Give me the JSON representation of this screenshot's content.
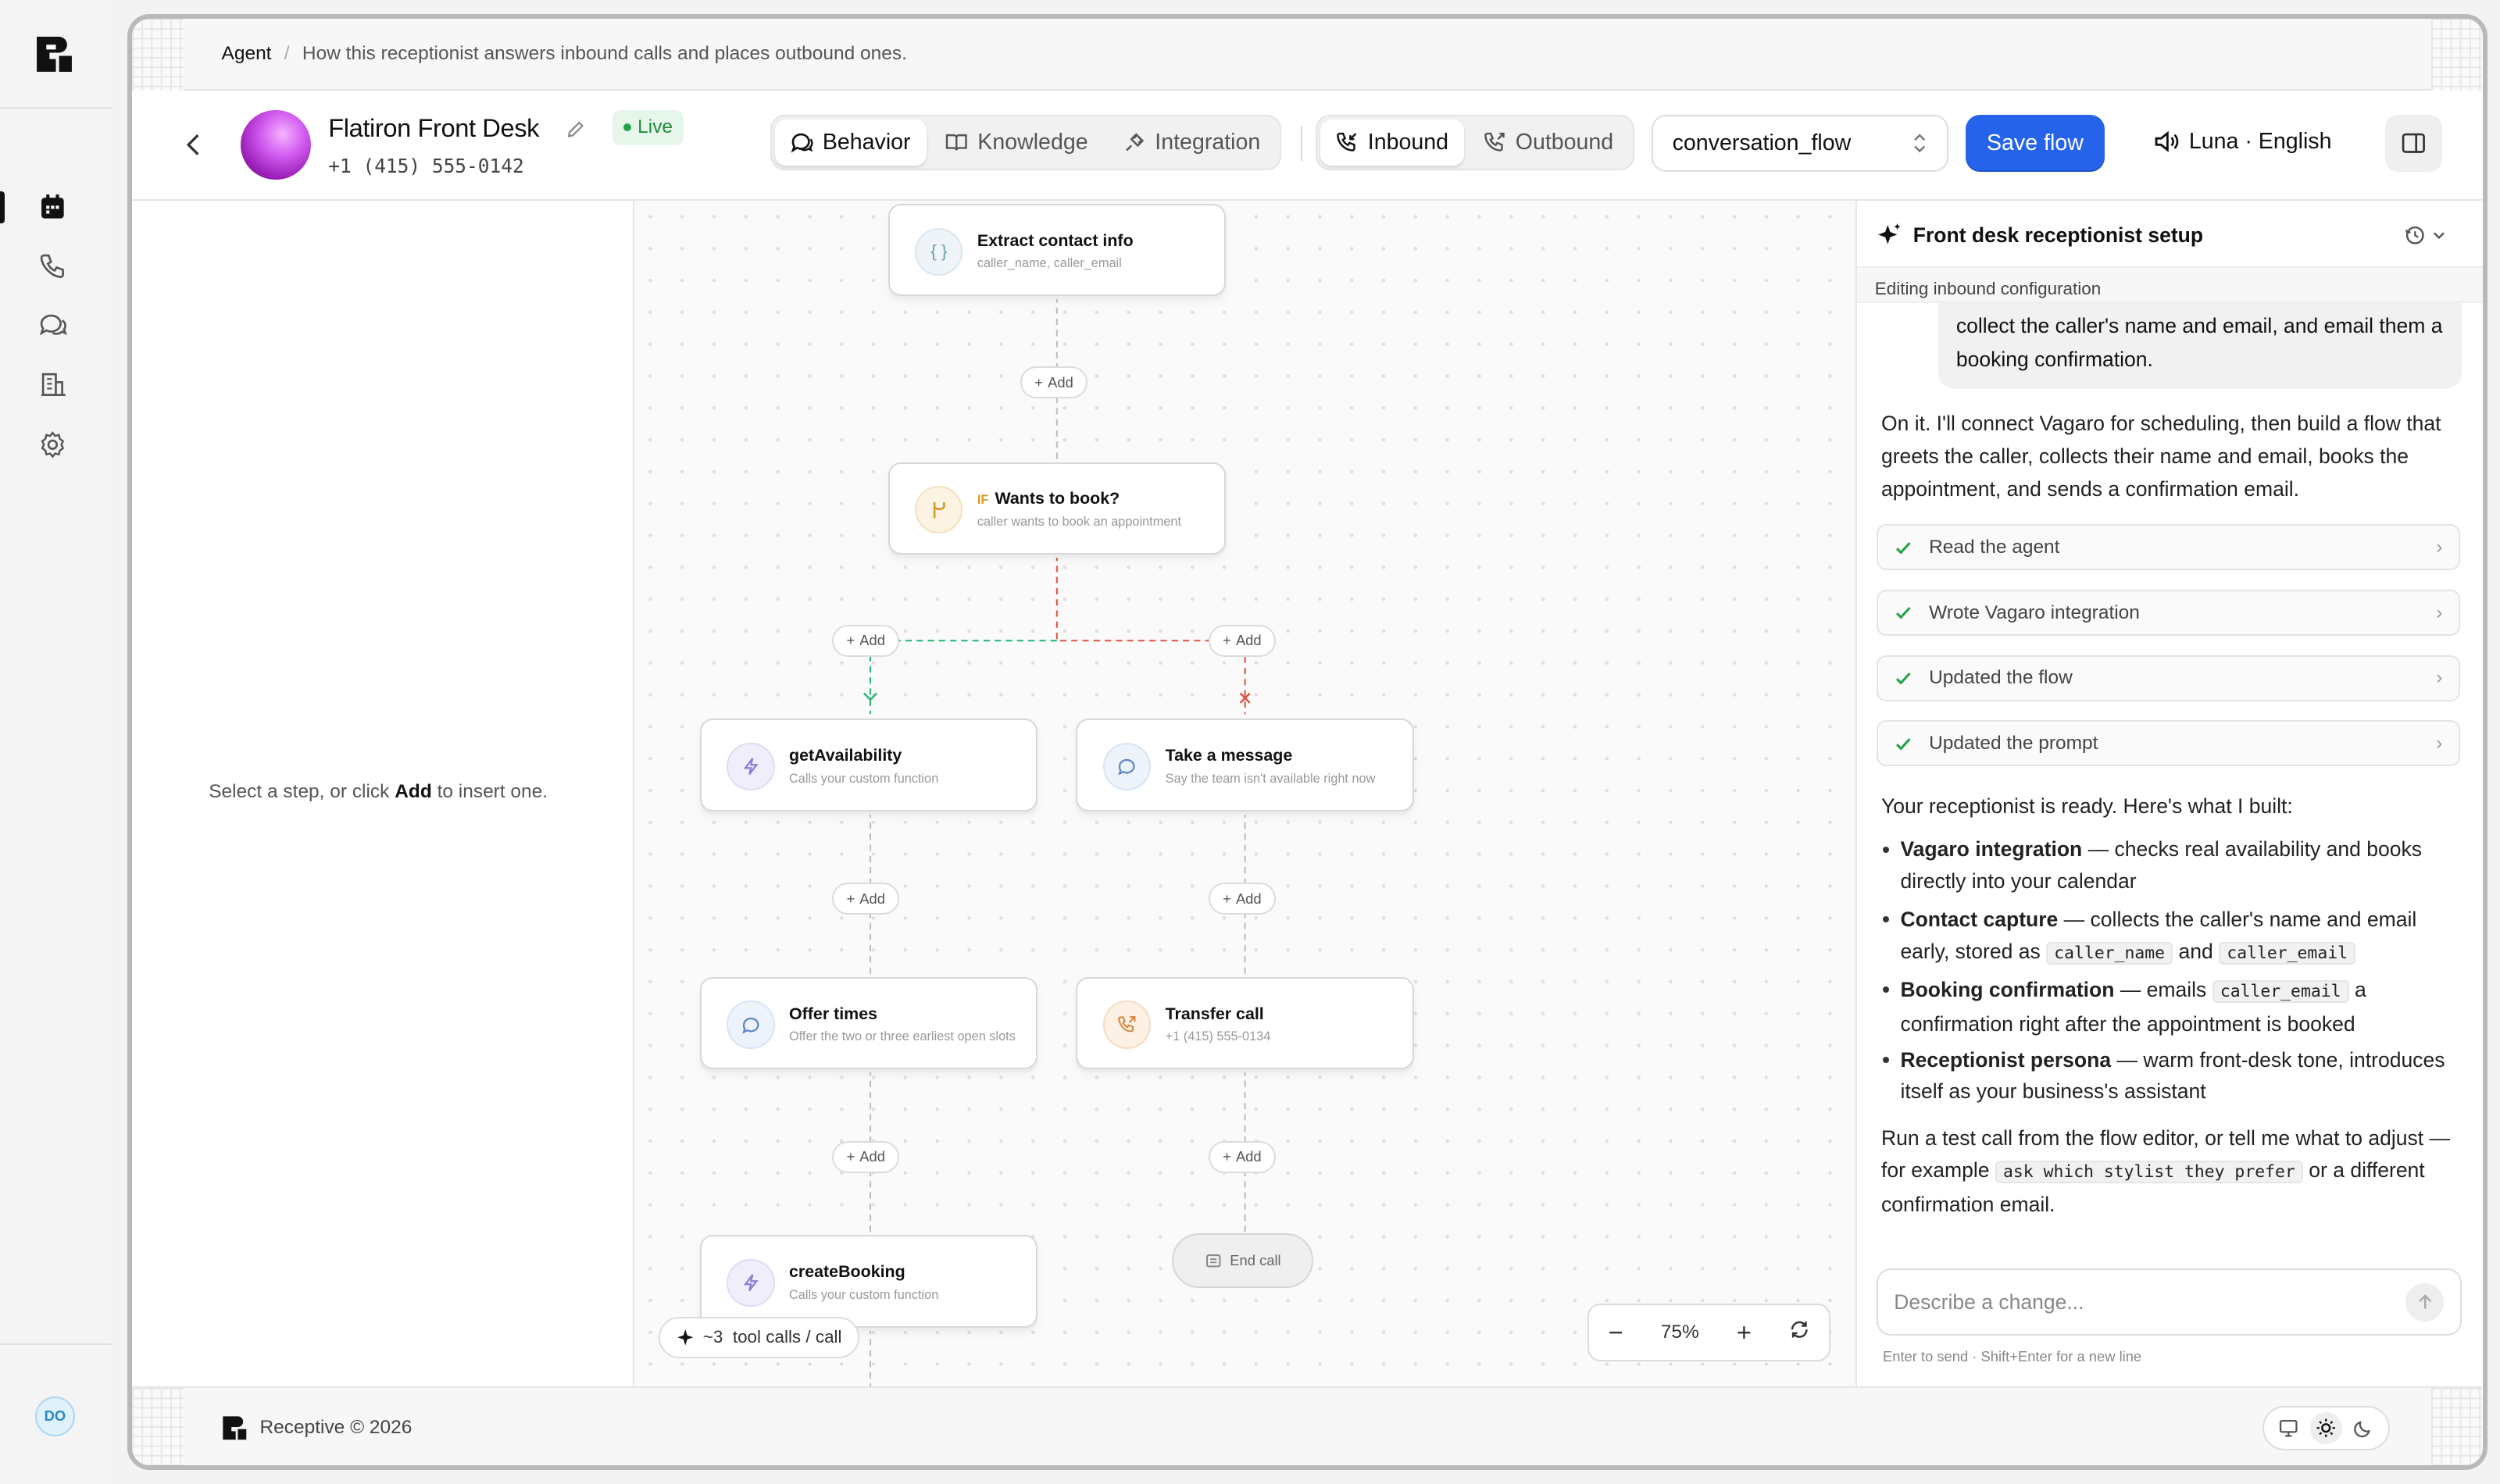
{
  "breadcrumb": {
    "root": "Agent",
    "separator": "/",
    "description": "How this receptionist answers inbound calls and places outbound ones."
  },
  "agent": {
    "name": "Flatiron Front Desk",
    "phone": "+1 (415) 555-0142",
    "status": "Live"
  },
  "tabs": [
    {
      "label": "Behavior",
      "icon": "chat-icon",
      "active": true
    },
    {
      "label": "Knowledge",
      "icon": "book-icon",
      "active": false
    },
    {
      "label": "Integration",
      "icon": "plug-icon",
      "active": false
    }
  ],
  "direction": [
    {
      "label": "Inbound",
      "icon": "incoming-call-icon",
      "active": true
    },
    {
      "label": "Outbound",
      "icon": "outgoing-call-icon",
      "active": false
    }
  ],
  "flow_select": {
    "value": "conversation_flow"
  },
  "save_label": "Save flow",
  "voice": {
    "label": "Luna · English"
  },
  "left_pane": {
    "hint_before": "Select a step, or click ",
    "hint_bold": "Add",
    "hint_after": " to insert one."
  },
  "flow": {
    "nodes": {
      "extract": {
        "title": "Extract contact info",
        "subtitle": "caller_name, caller_email"
      },
      "wants_book": {
        "prefix": "IF",
        "title": "Wants to book?",
        "subtitle": "caller wants to book an appointment"
      },
      "get_availability": {
        "title": "getAvailability",
        "subtitle": "Calls your custom function"
      },
      "take_message": {
        "title": "Take a message",
        "subtitle": "Say the team isn't available right now"
      },
      "offer_times": {
        "title": "Offer times",
        "subtitle": "Offer the two or three earliest open slots"
      },
      "transfer_call": {
        "title": "Transfer call",
        "subtitle": "+1 (415) 555-0134"
      },
      "create_booking": {
        "title": "createBooking",
        "subtitle": "Calls your custom function"
      }
    },
    "add_label": "Add",
    "end_call": "End call",
    "tool_calls": "~3  tool calls / call",
    "zoom": "75%"
  },
  "assistant": {
    "title": "Front desk receptionist setup",
    "subtitle": "Editing inbound configuration",
    "user_message": "collect the caller's name and email, and email them a booking confirmation.",
    "intro": "On it. I'll connect Vagaro for scheduling, then build a flow that greets the caller, collects their name and email, books the appointment, and sends a confirmation email.",
    "steps": [
      "Read the agent",
      "Wrote Vagaro integration",
      "Updated the flow",
      "Updated the prompt"
    ],
    "ready": "Your receptionist is ready. Here's what I built:",
    "bullets": [
      {
        "title": "Vagaro integration",
        "text": " — checks real availability and books directly into your calendar"
      },
      {
        "title": "Contact capture",
        "text": " — collects the caller's name and email early, stored as ",
        "code1": "caller_name",
        "mid": " and ",
        "code2": "caller_email"
      },
      {
        "title": "Booking confirmation",
        "text": " — emails ",
        "code1": "caller_email",
        "after": " a confirmation right after the appointment is booked"
      },
      {
        "title": "Receptionist persona",
        "text": " — warm front-desk tone, introduces itself as your business's assistant"
      }
    ],
    "outro_before": "Run a test call from the flow editor, or tell me what to adjust — for example ",
    "outro_code": "ask which stylist they prefer",
    "outro_after": " or a different confirmation email.",
    "composer_placeholder": "Describe a change...",
    "composer_hint": "Enter to send · Shift+Enter for a new line"
  },
  "footer": {
    "brand": "Receptive © 2026"
  },
  "rail": {
    "avatar": "DO"
  },
  "colors": {
    "accent": "#2563eb",
    "live": "#22a34a",
    "yes_branch": "#22b573",
    "no_branch": "#e0523f"
  }
}
